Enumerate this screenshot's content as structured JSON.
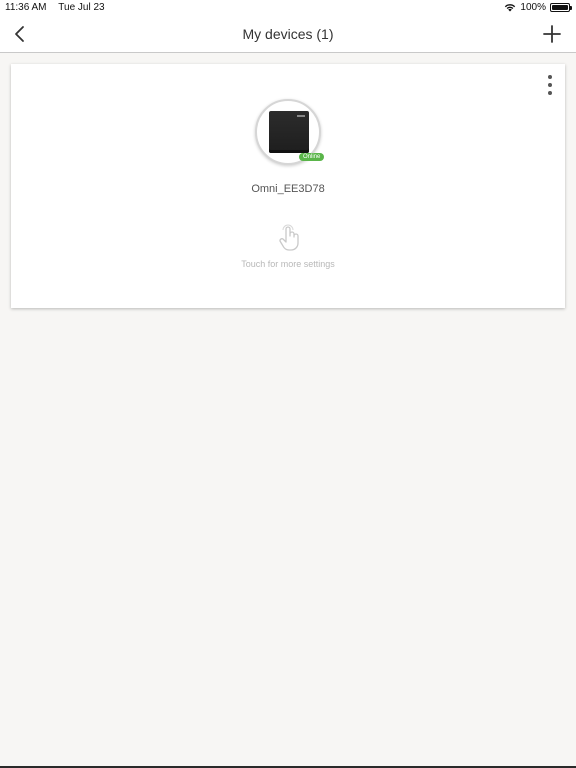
{
  "status_bar": {
    "time": "11:36 AM",
    "date": "Tue Jul 23",
    "battery": "100%"
  },
  "nav": {
    "back_icon": "chevron-left-icon",
    "title": "My devices (1)",
    "add_icon": "plus-icon"
  },
  "device": {
    "name": "Omni_EE3D78",
    "status": "Online",
    "status_color": "#5ab54a",
    "hint": "Touch for more settings",
    "more_icon": "vertical-ellipsis-icon",
    "touch_icon": "hand-pointer-icon"
  }
}
